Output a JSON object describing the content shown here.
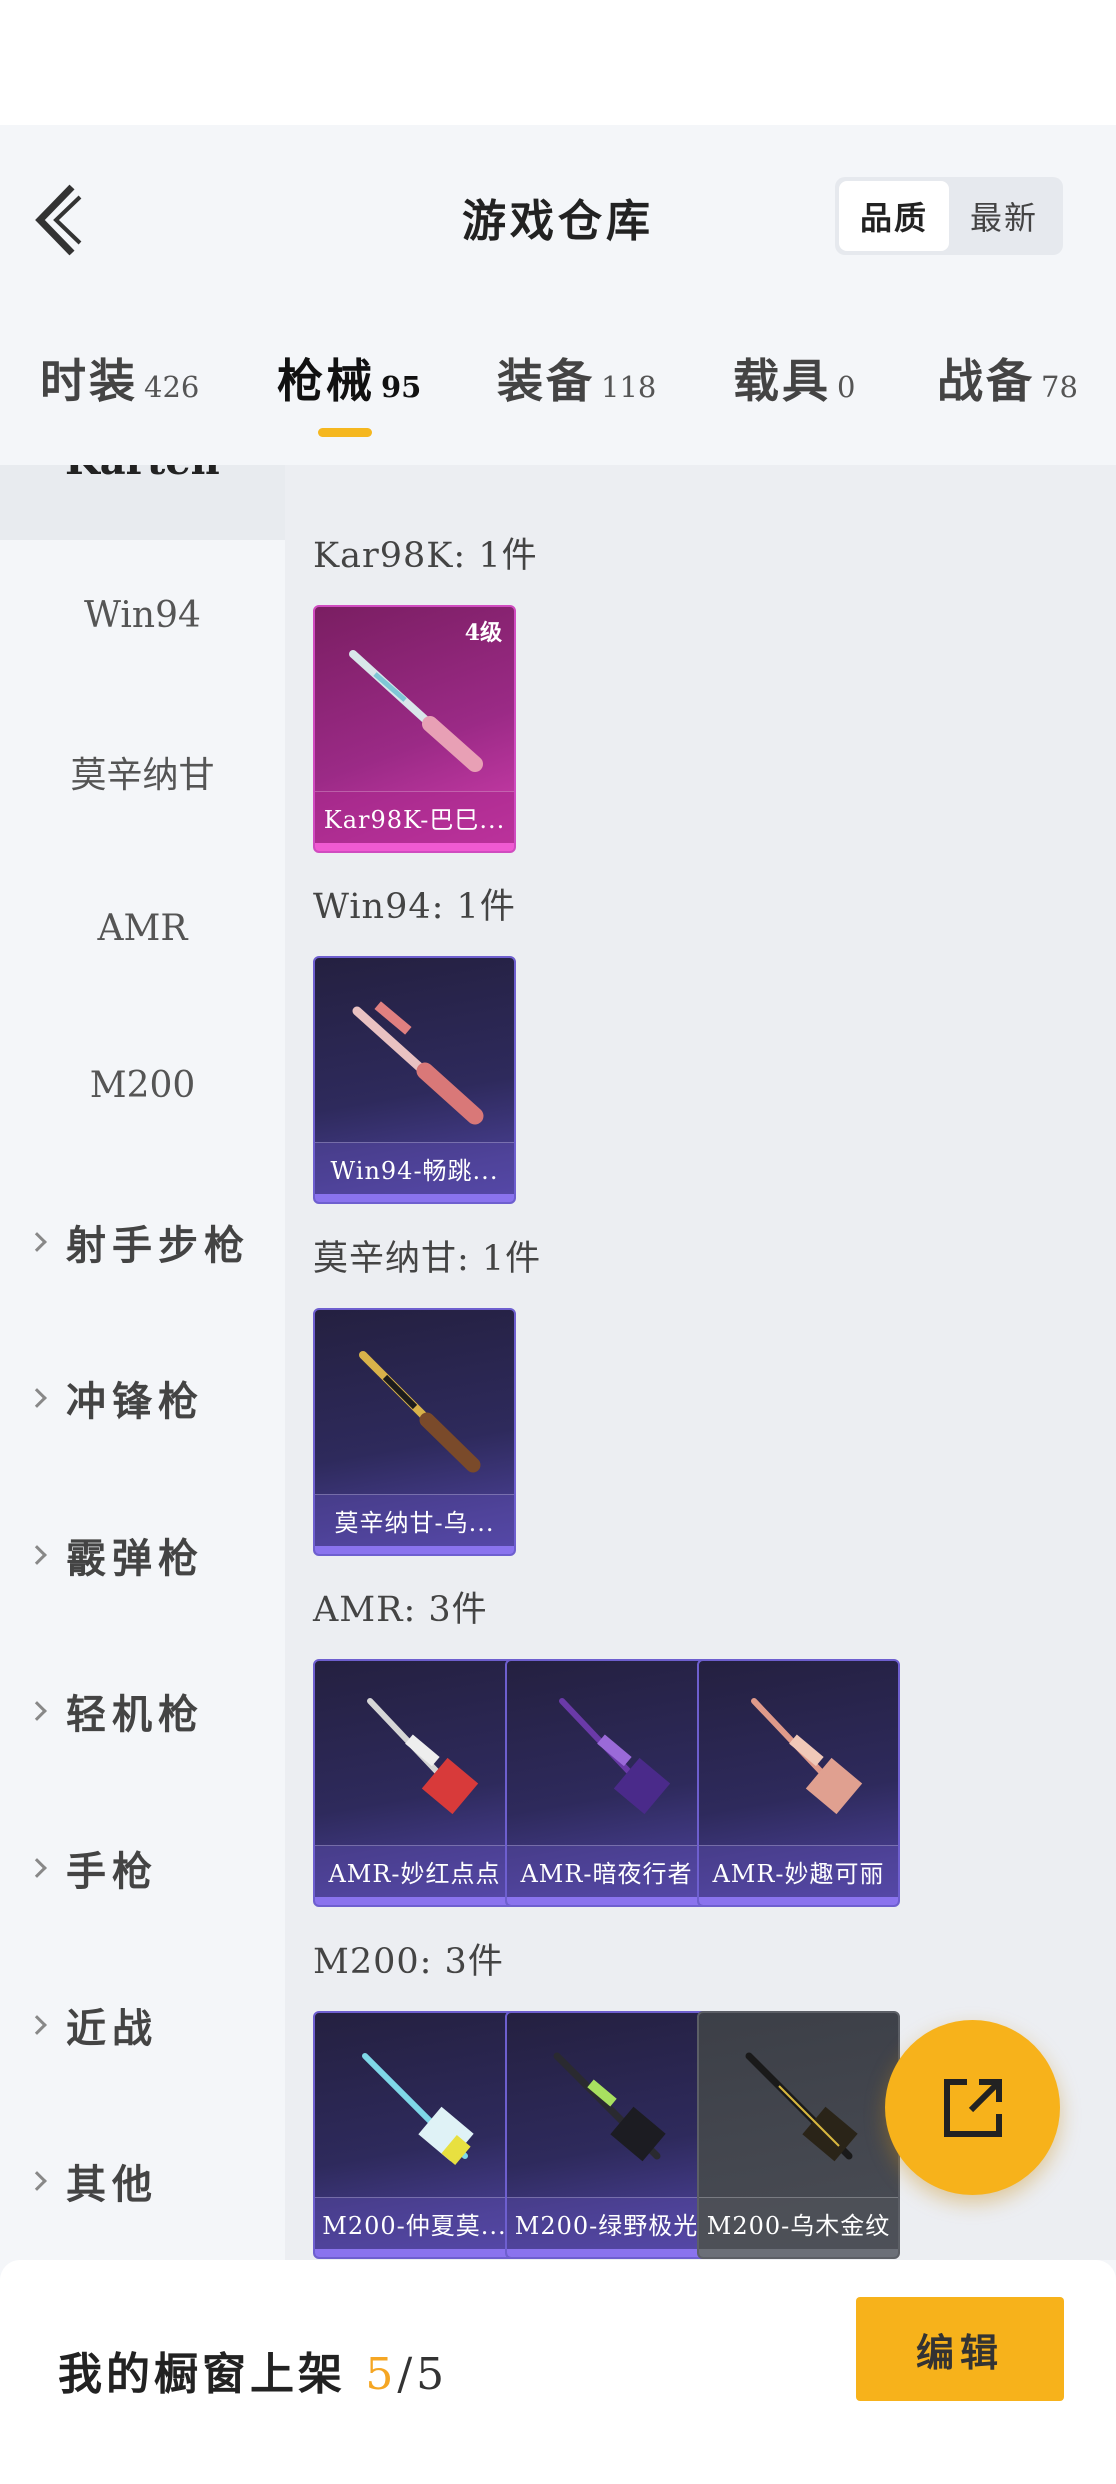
{
  "header": {
    "title": "游戏仓库",
    "sort_options": [
      "品质",
      "最新"
    ],
    "active_sort": "品质"
  },
  "tabs": [
    {
      "label": "时装",
      "count": "426"
    },
    {
      "label": "枪械",
      "count": "95",
      "active": true
    },
    {
      "label": "装备",
      "count": "118"
    },
    {
      "label": "载具",
      "count": "0"
    },
    {
      "label": "战备",
      "count": "78"
    }
  ],
  "sidebar": {
    "partial_item": "Karten",
    "items": [
      {
        "label": "Win94",
        "type": "sub"
      },
      {
        "label": "莫辛纳甘",
        "type": "sub"
      },
      {
        "label": "AMR",
        "type": "sub"
      },
      {
        "label": "M200",
        "type": "sub"
      },
      {
        "label": "射手步枪",
        "type": "category"
      },
      {
        "label": "冲锋枪",
        "type": "category"
      },
      {
        "label": "霰弹枪",
        "type": "category"
      },
      {
        "label": "轻机枪",
        "type": "category"
      },
      {
        "label": "手枪",
        "type": "category"
      },
      {
        "label": "近战",
        "type": "category"
      },
      {
        "label": "其他",
        "type": "category"
      }
    ]
  },
  "groups": [
    {
      "title": "Kar98K: 1件",
      "items": [
        {
          "name": "Kar98K-巴巳...",
          "level": "4级",
          "rarity": "pink"
        }
      ]
    },
    {
      "title": "Win94: 1件",
      "items": [
        {
          "name": "Win94-畅跳...",
          "rarity": "purple"
        }
      ]
    },
    {
      "title": "莫辛纳甘: 1件",
      "items": [
        {
          "name": "莫辛纳甘-乌...",
          "rarity": "purple"
        }
      ]
    },
    {
      "title": "AMR: 3件",
      "items": [
        {
          "name": "AMR-妙红点点",
          "rarity": "purple"
        },
        {
          "name": "AMR-暗夜行者",
          "rarity": "purple"
        },
        {
          "name": "AMR-妙趣可丽",
          "rarity": "purple"
        }
      ]
    },
    {
      "title": "M200: 3件",
      "items": [
        {
          "name": "M200-仲夏莫...",
          "rarity": "purple"
        },
        {
          "name": "M200-绿野极光",
          "rarity": "purple"
        },
        {
          "name": "M200-乌木金纹",
          "rarity": "gray"
        }
      ]
    }
  ],
  "footer": {
    "label": "我的橱窗上架",
    "count": "5",
    "total": "/5",
    "edit_label": "编辑"
  },
  "colors": {
    "accent": "#f7b21b",
    "tab_underline": "#f5b71f",
    "count_highlight": "#f5a623"
  },
  "icons": {
    "back": "chevron-left-icon",
    "fab": "share-external-icon"
  }
}
